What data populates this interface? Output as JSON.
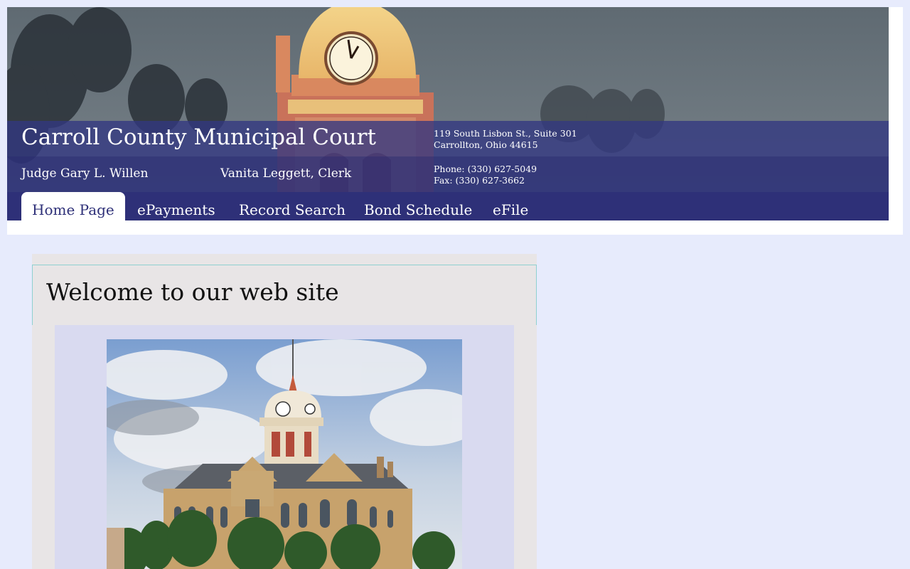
{
  "header": {
    "title": "Carroll County Municipal Court",
    "address_line1": "119 South Lisbon St., Suite 301",
    "address_line2": "Carrollton, Ohio 44615",
    "judge": "Judge Gary L. Willen",
    "clerk": "Vanita Leggett, Clerk",
    "phone": "Phone: (330) 627-5049",
    "fax": "Fax: (330) 627-3662"
  },
  "nav": {
    "items": [
      {
        "label": "Home Page",
        "active": true
      },
      {
        "label": "ePayments"
      },
      {
        "label": "Record Search"
      },
      {
        "label": "Bond Schedule"
      },
      {
        "label": "eFile"
      }
    ]
  },
  "main": {
    "heading": "Welcome to our web site"
  },
  "colors": {
    "page_bg": "#e7ebfc",
    "nav_bg": "#2e3078",
    "content_bg": "#e8e5e6"
  }
}
